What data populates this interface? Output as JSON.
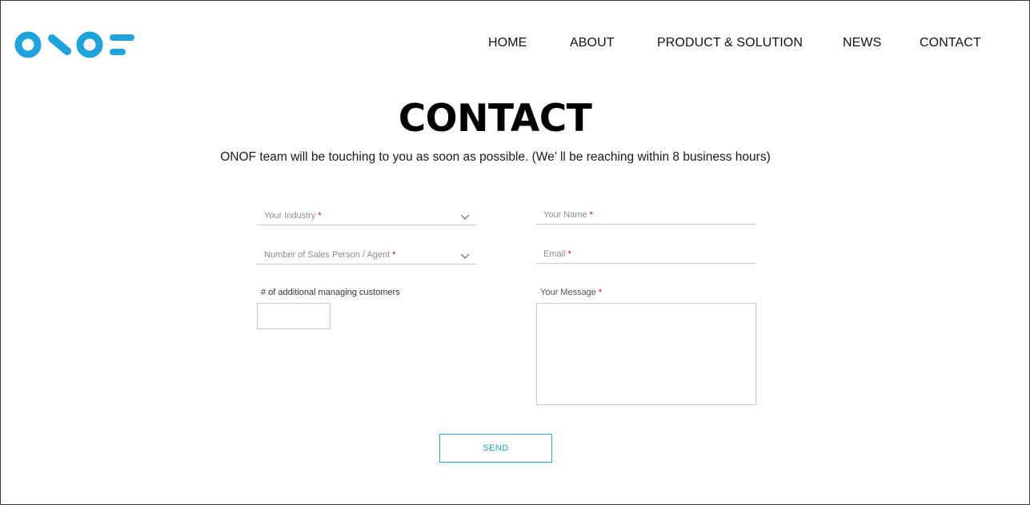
{
  "brand": {
    "logo_text": "ONOF",
    "color": "#1fa3dc"
  },
  "nav": {
    "home": "HOME",
    "about": "ABOUT",
    "product": "PRODUCT & SOLUTION",
    "news": "NEWS",
    "contact": "CONTACT"
  },
  "page": {
    "title": "CONTACT",
    "subtitle": "ONOF team will be touching to you as soon as possible. (We’ ll be reaching within 8 business hours)"
  },
  "form": {
    "industry": {
      "label": "Your Industry",
      "required": "*",
      "icon": "chevron-down-icon"
    },
    "name": {
      "label": "Your Name",
      "required": "*"
    },
    "sales": {
      "label": "Number of Sales Person / Agent",
      "required": "*",
      "icon": "chevron-down-icon"
    },
    "email": {
      "label": "Email",
      "required": "*"
    },
    "managing": {
      "label": "# of additional managing customers",
      "value": ""
    },
    "message": {
      "label": "Your Message",
      "required": "*",
      "value": ""
    },
    "send_label": "SEND"
  },
  "colors": {
    "accent": "#1fa3dc",
    "required": "#d0021b",
    "border": "#c9c9c9"
  }
}
